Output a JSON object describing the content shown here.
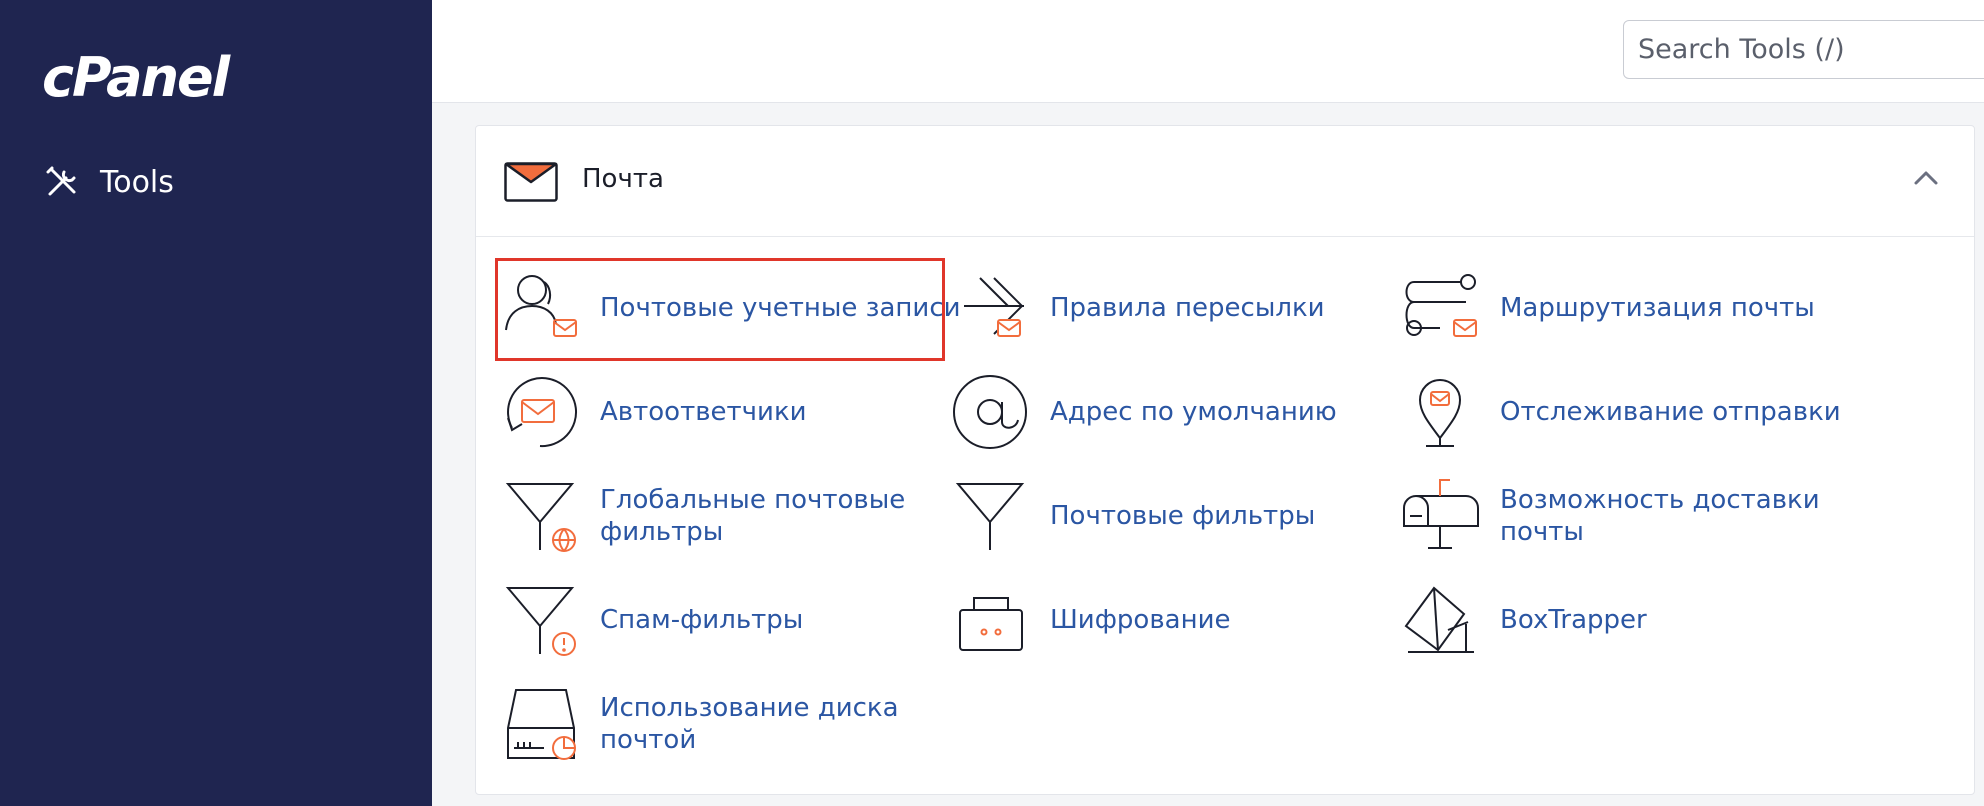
{
  "sidebar": {
    "logo": "cPanel",
    "nav": [
      {
        "label": "Tools",
        "icon": "tools-icon"
      }
    ]
  },
  "search": {
    "placeholder": "Search Tools (/)",
    "value": ""
  },
  "section": {
    "title": "Почта",
    "icon": "envelope-icon",
    "collapse_icon": "chevron-up-icon",
    "items": [
      {
        "label": "Почтовые учетные записи",
        "icon": "email-accounts-icon",
        "highlighted": true
      },
      {
        "label": "Правила пересылки",
        "icon": "forwarders-icon"
      },
      {
        "label": "Маршрутизация почты",
        "icon": "email-routing-icon"
      },
      {
        "label": "Автоответчики",
        "icon": "autoresponders-icon"
      },
      {
        "label": "Адрес по умолчанию",
        "icon": "at-sign-icon"
      },
      {
        "label": "Отслеживание отправки",
        "icon": "track-delivery-icon"
      },
      {
        "label": "Глобальные почтовые фильтры",
        "icon": "global-filter-icon"
      },
      {
        "label": "Почтовые фильтры",
        "icon": "filter-icon"
      },
      {
        "label": "Возможность доставки почты",
        "icon": "mailbox-icon"
      },
      {
        "label": "Спам-фильтры",
        "icon": "spam-filter-icon"
      },
      {
        "label": "Шифрование",
        "icon": "encryption-icon"
      },
      {
        "label": "BoxTrapper",
        "icon": "boxtrapper-icon"
      },
      {
        "label": "Использование диска почтой",
        "icon": "disk-usage-icon"
      }
    ]
  },
  "colors": {
    "sidebar_bg": "#1f2550",
    "link": "#2b56a3",
    "accent_orange": "#f26d3d",
    "highlight_border": "#e0362a"
  }
}
